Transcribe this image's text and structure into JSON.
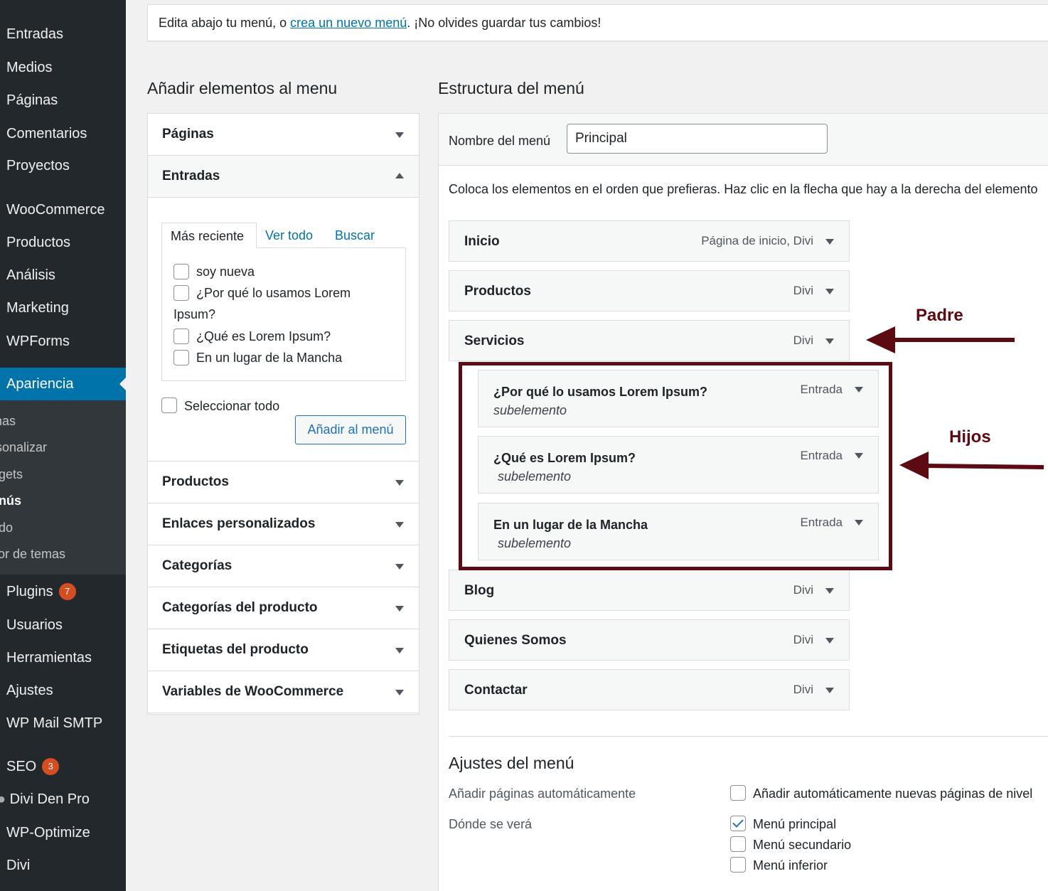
{
  "sidebar": {
    "items": [
      {
        "label": "Entradas"
      },
      {
        "label": "Medios"
      },
      {
        "label": "Páginas"
      },
      {
        "label": "Comentarios"
      },
      {
        "label": "Proyectos"
      },
      {
        "label": "WooCommerce"
      },
      {
        "label": "Productos"
      },
      {
        "label": "Análisis"
      },
      {
        "label": "Marketing"
      },
      {
        "label": "WPForms"
      }
    ],
    "active": "Apariencia",
    "submenu": [
      "mas",
      "rsonalizar",
      "dgets",
      "enús",
      "ndo",
      "itor de temas"
    ],
    "lower_items": [
      {
        "label": "Plugins",
        "badge": "7"
      },
      {
        "label": "Usuarios"
      },
      {
        "label": "Herramientas"
      },
      {
        "label": "Ajustes"
      },
      {
        "label": "WP Mail SMTP"
      },
      {
        "label": "SEO",
        "badge": "3"
      },
      {
        "label": "Divi Den Pro"
      },
      {
        "label": "WP-Optimize"
      },
      {
        "label": "Divi"
      }
    ]
  },
  "notice": {
    "before": "Edita abajo tu menú, o ",
    "link": "crea un nuevo menú",
    "after": ". ¡No olvides guardar tus cambios!"
  },
  "add_items": {
    "heading": "Añadir elementos al menu",
    "sections": [
      "Páginas",
      "Entradas",
      "Productos",
      "Enlaces personalizados",
      "Categorías",
      "Categorías del producto",
      "Etiquetas del producto",
      "Variables de WooCommerce"
    ],
    "tabs": [
      "Más reciente",
      "Ver todo",
      "Buscar"
    ],
    "posts": [
      "soy nueva",
      "¿Por qué lo usamos Lorem",
      "Ipsum?",
      "¿Qué es Lorem Ipsum?",
      "En un lugar de la Mancha"
    ],
    "select_all": "Seleccionar todo",
    "add_button": "Añadir al menú"
  },
  "structure": {
    "heading": "Estructura del menú",
    "name_label": "Nombre del menú",
    "name_value": "Principal",
    "instructions": "Coloca los elementos en el orden que prefieras. Haz clic en la flecha que hay a la derecha del elemento",
    "items": [
      {
        "title": "Inicio",
        "type": "Página de inicio, Divi"
      },
      {
        "title": "Productos",
        "type": "Divi"
      },
      {
        "title": "Servicios",
        "type": "Divi"
      },
      {
        "title": "Blog",
        "type": "Divi"
      },
      {
        "title": "Quienes Somos",
        "type": "Divi"
      },
      {
        "title": "Contactar",
        "type": "Divi"
      }
    ],
    "subitems": [
      {
        "title": "¿Por qué lo usamos Lorem Ipsum?",
        "sub": "subelemento",
        "type": "Entrada"
      },
      {
        "title": "¿Qué es Lorem Ipsum?",
        "sub": "subelemento",
        "type": "Entrada"
      },
      {
        "title": "En un lugar de la Mancha",
        "sub": "subelemento",
        "type": "Entrada"
      }
    ]
  },
  "annotations": {
    "parent": "Padre",
    "children": "Hijos"
  },
  "settings": {
    "title": "Ajustes del menú",
    "auto_add_label": "Añadir páginas automáticamente",
    "auto_add_option": "Añadir automáticamente nuevas páginas de nivel",
    "where_label": "Dónde se verá",
    "locations": [
      {
        "label": "Menú principal",
        "checked": true
      },
      {
        "label": "Menú secundario",
        "checked": false
      },
      {
        "label": "Menú inferior",
        "checked": false
      }
    ]
  },
  "colors": {
    "sidebar": "#23282d",
    "accent": "#0073aa",
    "annotation": "#5c0b12"
  }
}
